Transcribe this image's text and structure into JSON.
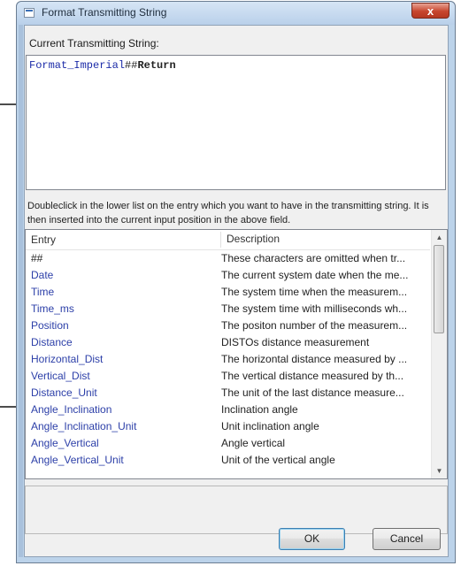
{
  "window": {
    "title": "Format Transmitting String",
    "close_glyph": "x"
  },
  "current": {
    "label": "Current Transmitting String:",
    "tokens": [
      {
        "text": "Format_Imperial",
        "kind": "field"
      },
      {
        "text": "##",
        "kind": "sep"
      },
      {
        "text": "Return",
        "kind": "kw"
      }
    ]
  },
  "instructions": "Doubleclick in the lower list on the entry which you want to have in the transmitting string. It is then inserted into the current input position in the above field.",
  "list": {
    "headers": {
      "entry": "Entry",
      "description": "Description"
    },
    "rows": [
      {
        "entry": "##",
        "description": "These characters are omitted when tr...",
        "plain": true
      },
      {
        "entry": "Date",
        "description": "The current system date when the me..."
      },
      {
        "entry": "Time",
        "description": "The system time when the measurem..."
      },
      {
        "entry": "Time_ms",
        "description": "The system time with milliseconds wh..."
      },
      {
        "entry": "Position",
        "description": "The positon number of the measurem..."
      },
      {
        "entry": "Distance",
        "description": "DISTOs distance measurement"
      },
      {
        "entry": "Horizontal_Dist",
        "description": "The horizontal distance measured  by ..."
      },
      {
        "entry": "Vertical_Dist",
        "description": "The vertical distance measured  by th..."
      },
      {
        "entry": "Distance_Unit",
        "description": "The unit of the last distance measure..."
      },
      {
        "entry": "Angle_Inclination",
        "description": "Inclination angle"
      },
      {
        "entry": "Angle_Inclination_Unit",
        "description": "Unit inclination angle"
      },
      {
        "entry": "Angle_Vertical",
        "description": "Angle vertical"
      },
      {
        "entry": "Angle_Vertical_Unit",
        "description": "Unit of the vertical angle"
      }
    ]
  },
  "buttons": {
    "ok": "OK",
    "cancel": "Cancel"
  },
  "icons": {
    "scroll_up": "▲",
    "scroll_down": "▼"
  }
}
